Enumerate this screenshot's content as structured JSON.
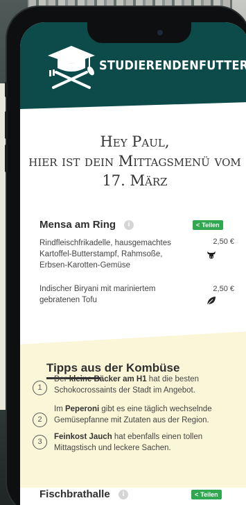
{
  "header": {
    "brand": "STUDIERENDENFUTTER",
    "brand_color": "#0d4a4a"
  },
  "greeting": {
    "line1": "Hey Paul,",
    "line2": "hier ist dein Mittagsmenü vom",
    "line3": "17. März"
  },
  "mensa": {
    "title": "Mensa am Ring",
    "info_icon": "info-icon",
    "share_label": "Teilen",
    "share_color": "#2fa84f",
    "dishes": [
      {
        "description": "Rindfleischfrikadelle, hausgemachtes Kartoffel-Butterstampf, Rahmsoße, Erbsen-Karotten-Gemüse",
        "price": "2,50 €",
        "diet_icon": "cow-icon"
      },
      {
        "description": "Indischer Biryani mit mariniertem gebratenen Tofu",
        "price": "2,50 €",
        "diet_icon": "leaf-icon"
      }
    ]
  },
  "tips": {
    "title": "Tipps aus der Kombüse",
    "items": [
      {
        "num": "1",
        "pre": "Der ",
        "bold": "kleine Bäcker am H1",
        "post": " hat die besten Schokocrossaints der Stadt im Angebot."
      },
      {
        "num": "2",
        "pre": "Im ",
        "bold": "Peperoni",
        "post": " gibt es eine täglich wechselnde Gemüsepfanne mit Zutaten aus der Region."
      },
      {
        "num": "3",
        "pre": "",
        "bold": "Feinkost Jauch",
        "post": " hat ebenfalls einen tollen Mittagstisch und leckere Sachen."
      }
    ],
    "background": "#fbf6d8"
  },
  "fischbrathalle": {
    "title": "Fischbrathalle",
    "share_label": "Teilen"
  }
}
